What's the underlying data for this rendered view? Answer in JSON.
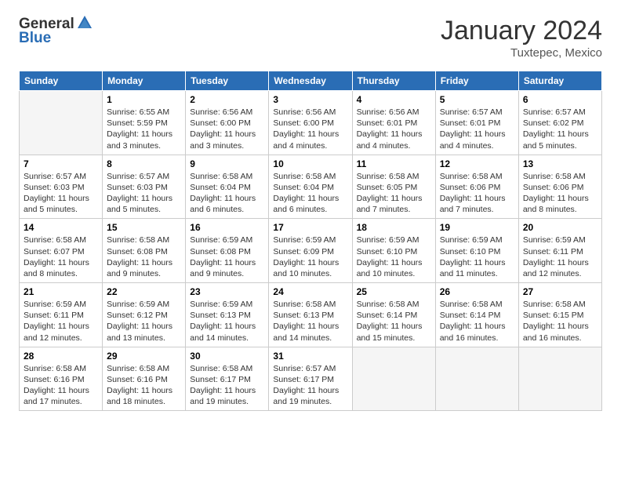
{
  "logo": {
    "general": "General",
    "blue": "Blue"
  },
  "header": {
    "month": "January 2024",
    "location": "Tuxtepec, Mexico"
  },
  "weekdays": [
    "Sunday",
    "Monday",
    "Tuesday",
    "Wednesday",
    "Thursday",
    "Friday",
    "Saturday"
  ],
  "weeks": [
    [
      {
        "day": "",
        "info": ""
      },
      {
        "day": "1",
        "info": "Sunrise: 6:55 AM\nSunset: 5:59 PM\nDaylight: 11 hours\nand 3 minutes."
      },
      {
        "day": "2",
        "info": "Sunrise: 6:56 AM\nSunset: 6:00 PM\nDaylight: 11 hours\nand 3 minutes."
      },
      {
        "day": "3",
        "info": "Sunrise: 6:56 AM\nSunset: 6:00 PM\nDaylight: 11 hours\nand 4 minutes."
      },
      {
        "day": "4",
        "info": "Sunrise: 6:56 AM\nSunset: 6:01 PM\nDaylight: 11 hours\nand 4 minutes."
      },
      {
        "day": "5",
        "info": "Sunrise: 6:57 AM\nSunset: 6:01 PM\nDaylight: 11 hours\nand 4 minutes."
      },
      {
        "day": "6",
        "info": "Sunrise: 6:57 AM\nSunset: 6:02 PM\nDaylight: 11 hours\nand 5 minutes."
      }
    ],
    [
      {
        "day": "7",
        "info": "Sunrise: 6:57 AM\nSunset: 6:03 PM\nDaylight: 11 hours\nand 5 minutes."
      },
      {
        "day": "8",
        "info": "Sunrise: 6:57 AM\nSunset: 6:03 PM\nDaylight: 11 hours\nand 5 minutes."
      },
      {
        "day": "9",
        "info": "Sunrise: 6:58 AM\nSunset: 6:04 PM\nDaylight: 11 hours\nand 6 minutes."
      },
      {
        "day": "10",
        "info": "Sunrise: 6:58 AM\nSunset: 6:04 PM\nDaylight: 11 hours\nand 6 minutes."
      },
      {
        "day": "11",
        "info": "Sunrise: 6:58 AM\nSunset: 6:05 PM\nDaylight: 11 hours\nand 7 minutes."
      },
      {
        "day": "12",
        "info": "Sunrise: 6:58 AM\nSunset: 6:06 PM\nDaylight: 11 hours\nand 7 minutes."
      },
      {
        "day": "13",
        "info": "Sunrise: 6:58 AM\nSunset: 6:06 PM\nDaylight: 11 hours\nand 8 minutes."
      }
    ],
    [
      {
        "day": "14",
        "info": "Sunrise: 6:58 AM\nSunset: 6:07 PM\nDaylight: 11 hours\nand 8 minutes."
      },
      {
        "day": "15",
        "info": "Sunrise: 6:58 AM\nSunset: 6:08 PM\nDaylight: 11 hours\nand 9 minutes."
      },
      {
        "day": "16",
        "info": "Sunrise: 6:59 AM\nSunset: 6:08 PM\nDaylight: 11 hours\nand 9 minutes."
      },
      {
        "day": "17",
        "info": "Sunrise: 6:59 AM\nSunset: 6:09 PM\nDaylight: 11 hours\nand 10 minutes."
      },
      {
        "day": "18",
        "info": "Sunrise: 6:59 AM\nSunset: 6:10 PM\nDaylight: 11 hours\nand 10 minutes."
      },
      {
        "day": "19",
        "info": "Sunrise: 6:59 AM\nSunset: 6:10 PM\nDaylight: 11 hours\nand 11 minutes."
      },
      {
        "day": "20",
        "info": "Sunrise: 6:59 AM\nSunset: 6:11 PM\nDaylight: 11 hours\nand 12 minutes."
      }
    ],
    [
      {
        "day": "21",
        "info": "Sunrise: 6:59 AM\nSunset: 6:11 PM\nDaylight: 11 hours\nand 12 minutes."
      },
      {
        "day": "22",
        "info": "Sunrise: 6:59 AM\nSunset: 6:12 PM\nDaylight: 11 hours\nand 13 minutes."
      },
      {
        "day": "23",
        "info": "Sunrise: 6:59 AM\nSunset: 6:13 PM\nDaylight: 11 hours\nand 14 minutes."
      },
      {
        "day": "24",
        "info": "Sunrise: 6:58 AM\nSunset: 6:13 PM\nDaylight: 11 hours\nand 14 minutes."
      },
      {
        "day": "25",
        "info": "Sunrise: 6:58 AM\nSunset: 6:14 PM\nDaylight: 11 hours\nand 15 minutes."
      },
      {
        "day": "26",
        "info": "Sunrise: 6:58 AM\nSunset: 6:14 PM\nDaylight: 11 hours\nand 16 minutes."
      },
      {
        "day": "27",
        "info": "Sunrise: 6:58 AM\nSunset: 6:15 PM\nDaylight: 11 hours\nand 16 minutes."
      }
    ],
    [
      {
        "day": "28",
        "info": "Sunrise: 6:58 AM\nSunset: 6:16 PM\nDaylight: 11 hours\nand 17 minutes."
      },
      {
        "day": "29",
        "info": "Sunrise: 6:58 AM\nSunset: 6:16 PM\nDaylight: 11 hours\nand 18 minutes."
      },
      {
        "day": "30",
        "info": "Sunrise: 6:58 AM\nSunset: 6:17 PM\nDaylight: 11 hours\nand 19 minutes."
      },
      {
        "day": "31",
        "info": "Sunrise: 6:57 AM\nSunset: 6:17 PM\nDaylight: 11 hours\nand 19 minutes."
      },
      {
        "day": "",
        "info": ""
      },
      {
        "day": "",
        "info": ""
      },
      {
        "day": "",
        "info": ""
      }
    ]
  ]
}
